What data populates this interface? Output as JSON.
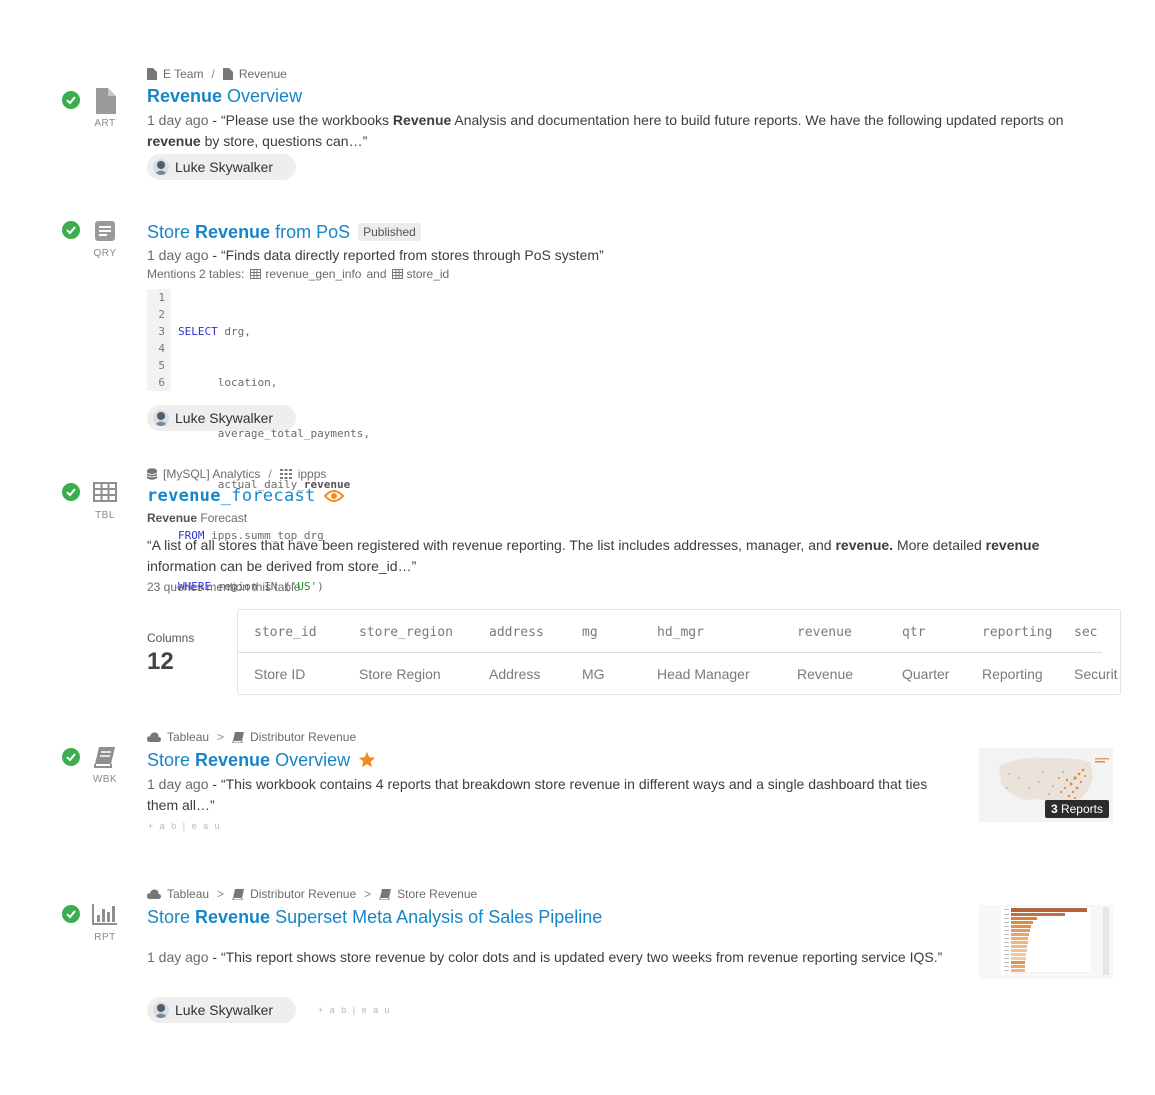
{
  "results": [
    {
      "type_label": "ART",
      "breadcrumb": [
        "E Team",
        "Revenue"
      ],
      "title_bold": "Revenue",
      "title_rest": " Overview",
      "ago": "1 day ago",
      "desc_a": " - “Please use the workbooks ",
      "desc_b": "Revenue",
      "desc_c": " Analysis and documentation here to build future reports. We have the following updated reports on ",
      "desc_d": "revenue",
      "desc_e": " by store, questions can…”",
      "owner": "Luke Skywalker"
    },
    {
      "type_label": "QRY",
      "title_a": "Store ",
      "title_bold": "Revenue",
      "title_rest": " from PoS",
      "badge": "Published",
      "ago": "1 day ago",
      "desc": " - “Finds data directly reported from stores through PoS system”",
      "mentions_prefix": "Mentions 2 tables:",
      "table1": "revenue_gen_info",
      "and": "and",
      "table2": "store_id",
      "code_line_numbers": [
        "1",
        "2",
        "3",
        "4",
        "5",
        "6"
      ],
      "code": {
        "l1_kw": "SELECT",
        "l1_rest": " drg,",
        "l2": "      location,",
        "l3": "      average_total_payments,",
        "l4_a": "      actual_daily_",
        "l4_b": "revenue",
        "l5_kw": "FROM",
        "l5_rest": " ipps.summ_top_drg",
        "l6_kw": "WHERE",
        "l6_rest": " region IN (",
        "l6_str": "'US'",
        "l6_end": ")"
      },
      "owner": "Luke Skywalker"
    },
    {
      "type_label": "TBL",
      "breadcrumb": [
        "[MySQL] Analytics",
        "ippps"
      ],
      "title_bold": "revenue",
      "title_rest": "_forecast",
      "subtitle_bold": "Revenue",
      "subtitle_rest": " Forecast",
      "desc_a": "“A list of all stores that have been registered with revenue reporting. The list includes addresses, manager, and ",
      "desc_b": "revenue.",
      "desc_c": " More detailed ",
      "desc_d": "revenue",
      "desc_e": " information can be derived from store_id…”",
      "queries_note": "23 queries mention this table",
      "columns_label": "Columns",
      "columns_count": "12",
      "column_names": [
        "store_id",
        "store_region",
        "address",
        "mg",
        "hd_mgr",
        "revenue",
        "qtr",
        "reporting",
        "sec"
      ],
      "column_titles": [
        "Store ID",
        "Store Region",
        "Address",
        "MG",
        "Head Manager",
        "Revenue",
        "Quarter",
        "Reporting",
        "Securit"
      ]
    },
    {
      "type_label": "WBK",
      "breadcrumb": [
        "Tableau",
        "Distributor Revenue"
      ],
      "breadcrumb_sep": ">",
      "title_a": "Store ",
      "title_bold": "Revenue",
      "title_rest": " Overview",
      "ago": "1 day ago",
      "desc": " - “This workbook contains 4 reports that breakdown store revenue in different ways and a single dashboard that ties them all…”",
      "reports_count": "3",
      "reports_label": "Reports",
      "logo_text": "+ a b | e a u"
    },
    {
      "type_label": "RPT",
      "breadcrumb": [
        "Tableau",
        "Distributor Revenue",
        "Store Revenue"
      ],
      "breadcrumb_sep": ">",
      "title_a": "Store ",
      "title_bold": "Revenue",
      "title_rest": " Superset Meta Analysis of Sales Pipeline",
      "ago": "1 day ago",
      "desc": " - “This report shows store revenue by color dots and is updated every two weeks from revenue reporting service IQS.”",
      "owner": "Luke Skywalker",
      "logo_text": "+ a b | e a u"
    }
  ],
  "colors": {
    "link": "#1786c8",
    "check": "#3cae4f",
    "eye": "#f08a1c",
    "star": "#f08a1c"
  }
}
